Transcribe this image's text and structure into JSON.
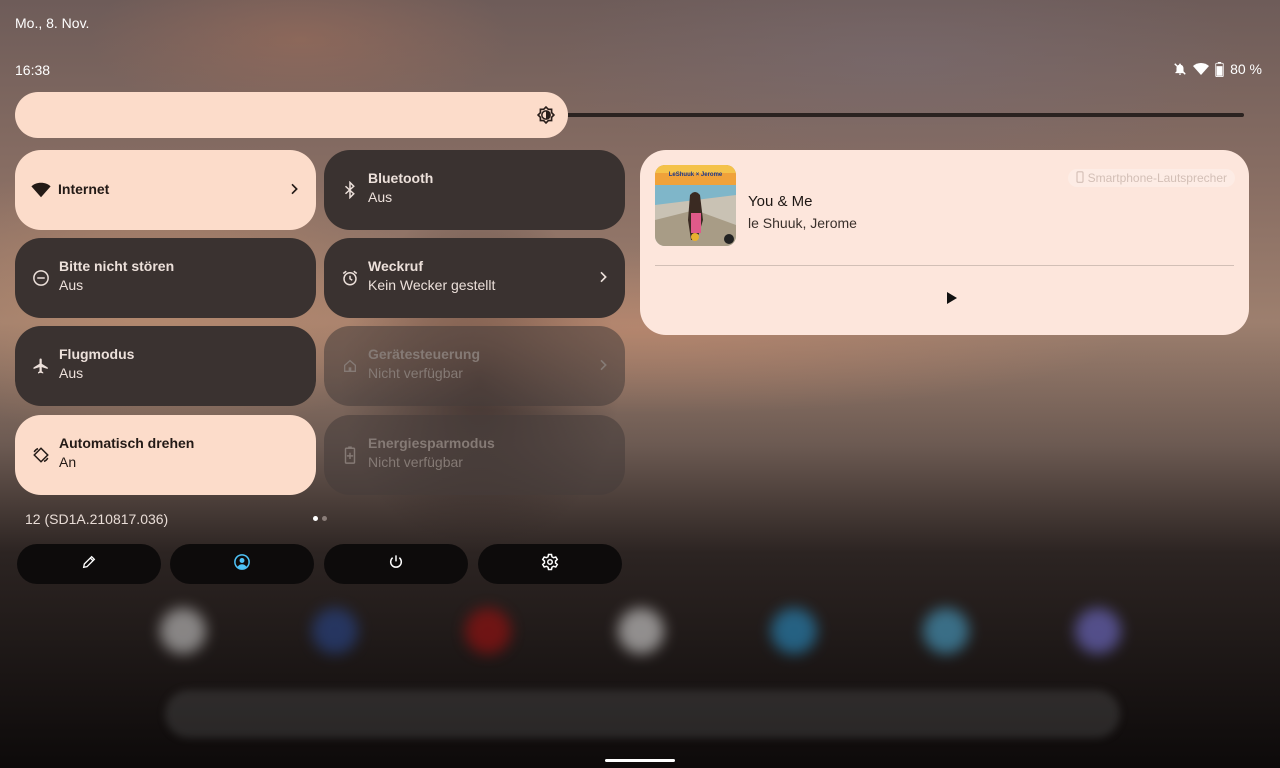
{
  "status_bar": {
    "date": "Mo., 8. Nov.",
    "time": "16:38",
    "battery": "80 %",
    "icons": [
      "notifications-off-icon",
      "wifi-icon",
      "battery-icon"
    ]
  },
  "brightness": {
    "level": 0.45,
    "icon": "brightness-icon"
  },
  "tiles": [
    {
      "title": "Internet",
      "subtitle": "",
      "state": "on",
      "icon": "wifi-icon",
      "chevron": true
    },
    {
      "title": "Bluetooth",
      "subtitle": "Aus",
      "state": "off",
      "icon": "bluetooth-icon",
      "chevron": false
    },
    {
      "title": "Bitte nicht stören",
      "subtitle": "Aus",
      "state": "off",
      "icon": "do-not-disturb-icon",
      "chevron": false
    },
    {
      "title": "Weckruf",
      "subtitle": "Kein Wecker gestellt",
      "state": "off",
      "icon": "alarm-icon",
      "chevron": true
    },
    {
      "title": "Flugmodus",
      "subtitle": "Aus",
      "state": "off",
      "icon": "airplane-icon",
      "chevron": false
    },
    {
      "title": "Gerätesteuerung",
      "subtitle": "Nicht verfügbar",
      "state": "unavailable",
      "icon": "home-icon",
      "chevron": true
    },
    {
      "title": "Automatisch drehen",
      "subtitle": "An",
      "state": "on",
      "icon": "auto-rotate-icon",
      "chevron": false
    },
    {
      "title": "Energiesparmodus",
      "subtitle": "Nicht verfügbar",
      "state": "unavailable",
      "icon": "battery-saver-icon",
      "chevron": false
    }
  ],
  "build_number": "12 (SD1A.210817.036)",
  "page_indicator": {
    "pages": 2,
    "active": 0
  },
  "footer_buttons": [
    "edit-icon",
    "user-icon",
    "power-icon",
    "settings-icon"
  ],
  "media": {
    "song": "You & Me",
    "artist": "le Shuuk, Jerome",
    "output_device": "Smartphone-Lautsprecher",
    "album_art_text": "LeShuuk × Jerome",
    "play_icon": "play-icon"
  },
  "colors": {
    "tile_on": "#fcdcca",
    "tile_off": "#3a3230",
    "media_bg": "#fde6dc",
    "accent_user": "#4fc3f7"
  }
}
